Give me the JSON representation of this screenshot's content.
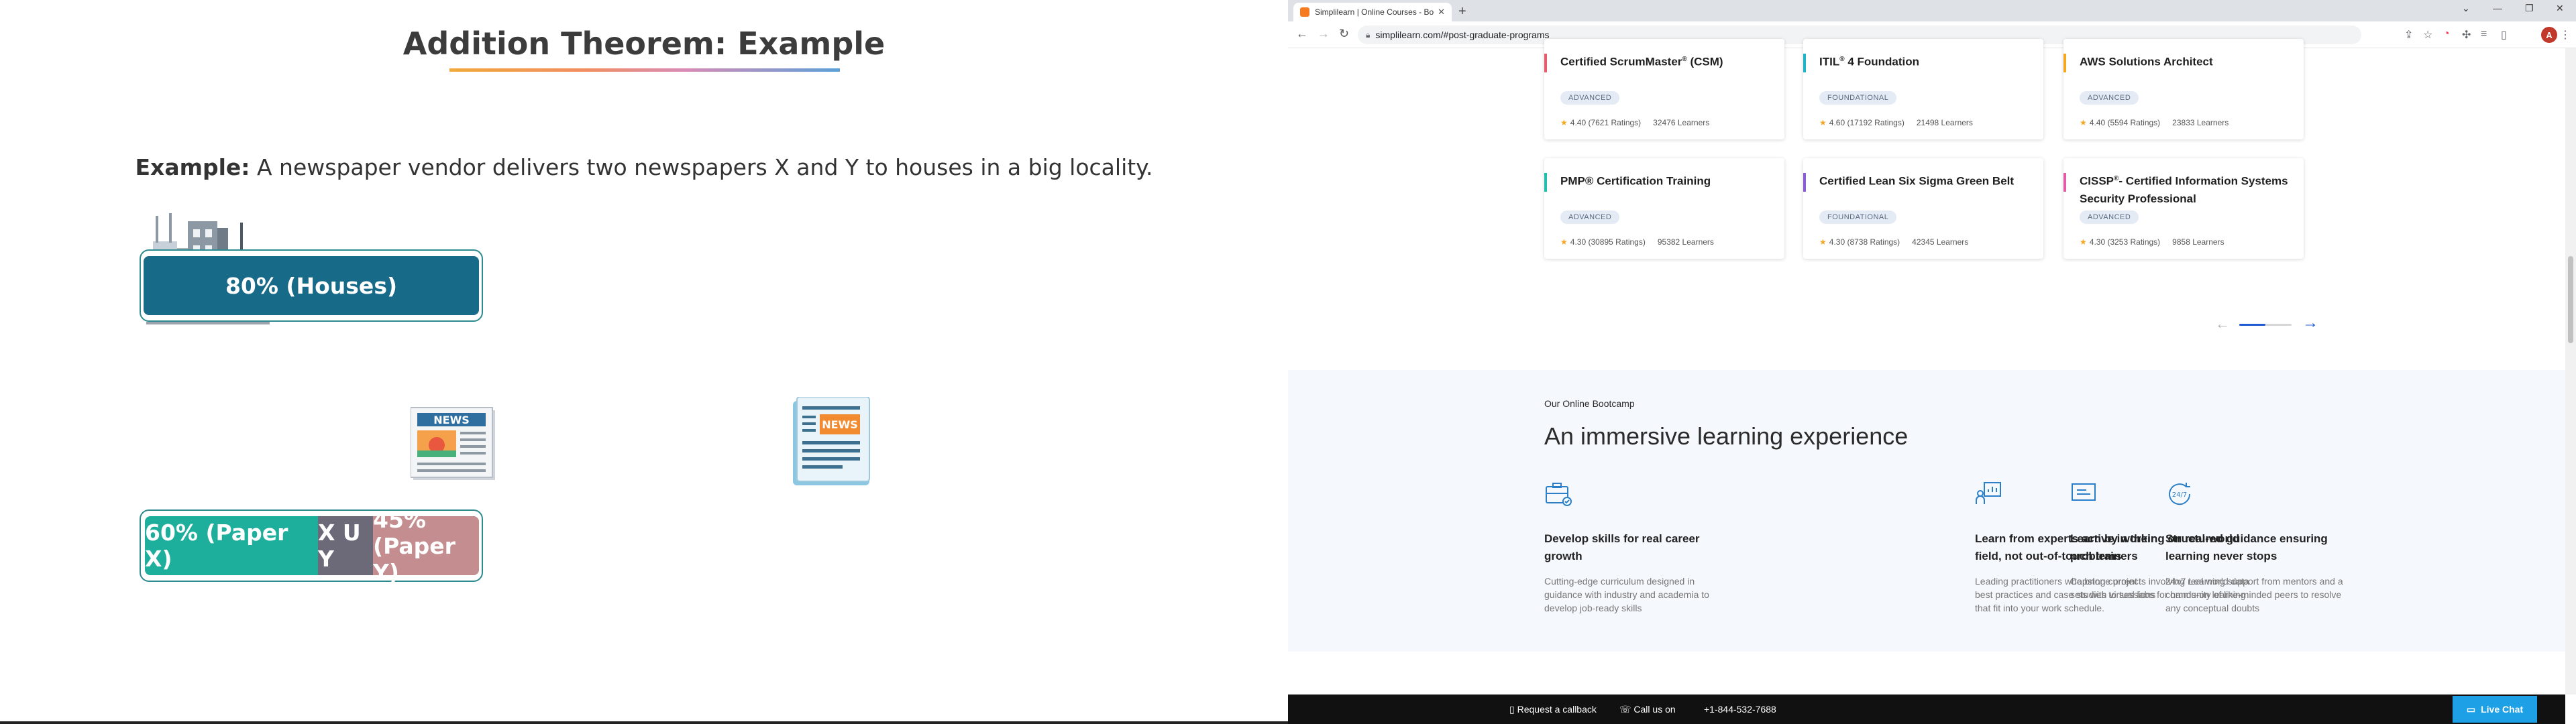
{
  "slide": {
    "title": "Addition Theorem: Example",
    "example_label": "Example:",
    "example_text": " A newspaper vendor delivers two newspapers X and Y to houses in a big locality.",
    "houses_bar_label": "80% (Houses)",
    "paper_x_label": "60% (Paper X)",
    "xuy_label": "X U Y",
    "paper_y_label": "45% (Paper Y)",
    "news_badge": "NEWS"
  },
  "browser": {
    "tab_title": "Simplilearn | Online Courses - Bo",
    "url": "simplilearn.com/#post-graduate-programs",
    "avatar_letter": "A"
  },
  "courses": [
    {
      "name_pre": "Certified ScrumMaster",
      "sup": "®",
      "name_post": " (CSM)",
      "level": "ADVANCED",
      "rating": "4.40 (7621 Ratings)",
      "learners": "32476 Learners",
      "accent": "#e85d6a"
    },
    {
      "name_pre": "ITIL",
      "sup": "®",
      "name_post": " 4 Foundation",
      "level": "FOUNDATIONAL",
      "rating": "4.60 (17192 Ratings)",
      "learners": "21498 Learners",
      "accent": "#1fb5c9"
    },
    {
      "name_pre": "AWS Solutions Architect",
      "sup": "",
      "name_post": "",
      "level": "ADVANCED",
      "rating": "4.40 (5594 Ratings)",
      "learners": "23833 Learners",
      "accent": "#f5a623"
    },
    {
      "name_pre": "PMP® Certification Training",
      "sup": "",
      "name_post": "",
      "level": "ADVANCED",
      "rating": "4.30 (30895 Ratings)",
      "learners": "95382 Learners",
      "accent": "#1fc0b0"
    },
    {
      "name_pre": "Certified Lean Six Sigma Green Belt",
      "sup": "",
      "name_post": "",
      "level": "FOUNDATIONAL",
      "rating": "4.30 (8738 Ratings)",
      "learners": "42345 Learners",
      "accent": "#8a5cd6"
    },
    {
      "name_pre": "CISSP",
      "sup": "®",
      "name_post": "- Certified Information Systems Security Professional",
      "level": "ADVANCED",
      "rating": "4.30 (3253 Ratings)",
      "learners": "9858 Learners",
      "accent": "#e35ca8"
    }
  ],
  "carousel": {
    "prev": "←",
    "next": "→",
    "progress": 0.5
  },
  "bootcamp": {
    "eyebrow": "Our Online Bootcamp",
    "title": "An immersive learning experience",
    "features": [
      {
        "heading": "Develop skills for real career growth",
        "desc": "Cutting-edge curriculum designed in guidance with industry and academia to develop job-ready skills",
        "icon": "briefcase-icon"
      },
      {
        "heading": "Learn from experts active in their field, not out-of-touch trainers",
        "desc": "Leading practitioners who bring current best practices and case studies to sessions that fit into your work schedule.",
        "icon": "presenter-chart-icon"
      },
      {
        "heading": "Learn by working on real-world problems",
        "desc": "Capstone projects involving real world data sets with virtual labs for hands-on learning",
        "icon": "monitor-icon"
      },
      {
        "heading": "Structured guidance ensuring learning never stops",
        "desc": "24x7 Learning support from mentors and a community of like-minded peers to resolve any conceptual doubts",
        "icon": "clock-24-7-icon"
      }
    ],
    "clock_label": "24/7"
  },
  "bottom_bar": {
    "request_callback": "Request a callback",
    "call_us": "Call us on",
    "phone": "+1-844-532-7688",
    "live_chat": "Live Chat"
  },
  "colors": {
    "houses_bar": "#176a88",
    "paper_x": "#1eaf9c",
    "xuy": "#6c6a78",
    "paper_y": "#c48d8f",
    "link_blue": "#1d5bd6"
  }
}
